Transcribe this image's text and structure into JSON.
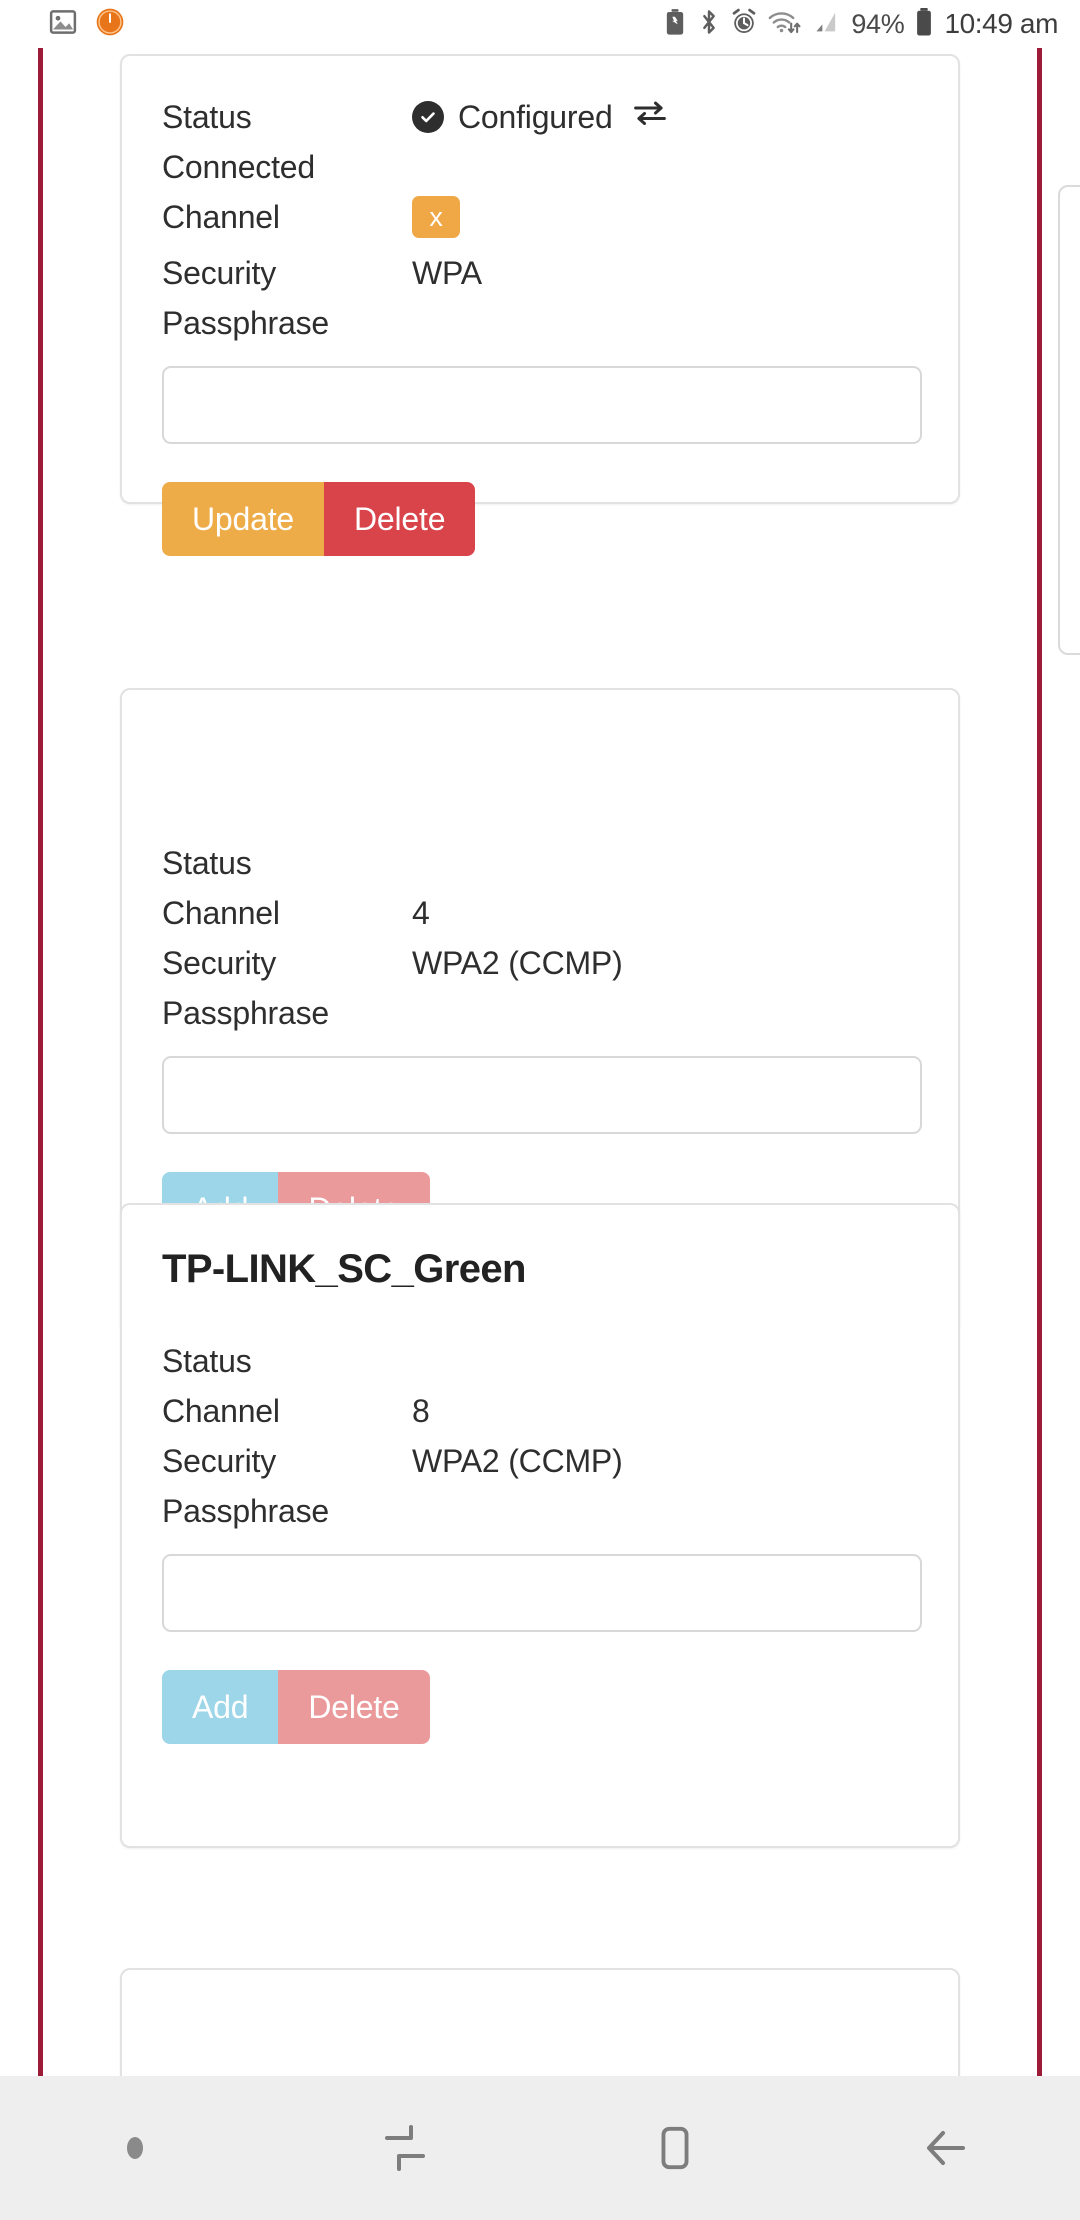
{
  "status_bar": {
    "left_icons": [
      {
        "name": "screenshot-image-icon"
      },
      {
        "name": "timer-orange-icon"
      }
    ],
    "right_icons": [
      {
        "name": "battery-saver-icon"
      },
      {
        "name": "bluetooth-icon"
      },
      {
        "name": "alarm-clock-icon"
      },
      {
        "name": "wifi-data-transfer-icon"
      },
      {
        "name": "cellular-signal-icon"
      }
    ],
    "battery_percent": "94%",
    "battery_icon": "battery-full-icon",
    "time": "10:49 am"
  },
  "theme": {
    "rail_color": "#9c1c38",
    "chip_orange": "#efa845",
    "update_orange": "#eeac48",
    "delete_red": "#d9434a",
    "add_disabled_blue": "#9cd6e8",
    "delete_disabled_red": "#eb9a9c",
    "navbar_bg": "#eeeeee",
    "card_border": "#e2e2e2"
  },
  "cards": [
    {
      "ssid": "",
      "status_label": "Status",
      "status_value": "Configured",
      "status_icon": "check-circle-icon",
      "status_transfer_icon": "transfer-arrows-icon",
      "connected_label": "Connected",
      "connected_value": "",
      "channel_label": "Channel",
      "channel_value": "x",
      "channel_is_chip": true,
      "security_label": "Security",
      "security_value": "WPA",
      "passphrase_label": "Passphrase",
      "passphrase_value": "",
      "passphrase_placeholder": "",
      "primary_button": "Update",
      "primary_button_state": "enabled",
      "delete_button": "Delete",
      "delete_button_state": "enabled"
    },
    {
      "ssid": "",
      "status_label": "Status",
      "status_value": "",
      "channel_label": "Channel",
      "channel_value": "4",
      "channel_is_chip": false,
      "security_label": "Security",
      "security_value": "WPA2 (CCMP)",
      "passphrase_label": "Passphrase",
      "passphrase_value": "",
      "passphrase_placeholder": "",
      "primary_button": "Add",
      "primary_button_state": "disabled",
      "delete_button": "Delete",
      "delete_button_state": "disabled"
    },
    {
      "ssid": "TP-LINK_SC_Green",
      "status_label": "Status",
      "status_value": "",
      "channel_label": "Channel",
      "channel_value": "8",
      "channel_is_chip": false,
      "security_label": "Security",
      "security_value": "WPA2 (CCMP)",
      "passphrase_label": "Passphrase",
      "passphrase_value": "",
      "passphrase_placeholder": "",
      "primary_button": "Add",
      "primary_button_state": "disabled",
      "delete_button": "Delete",
      "delete_button_state": "disabled"
    }
  ],
  "nav_bar": {
    "items": [
      {
        "name": "nav-dot-indicator",
        "label": ""
      },
      {
        "name": "recents-icon",
        "label": ""
      },
      {
        "name": "home-icon",
        "label": ""
      },
      {
        "name": "back-icon",
        "label": ""
      }
    ]
  }
}
